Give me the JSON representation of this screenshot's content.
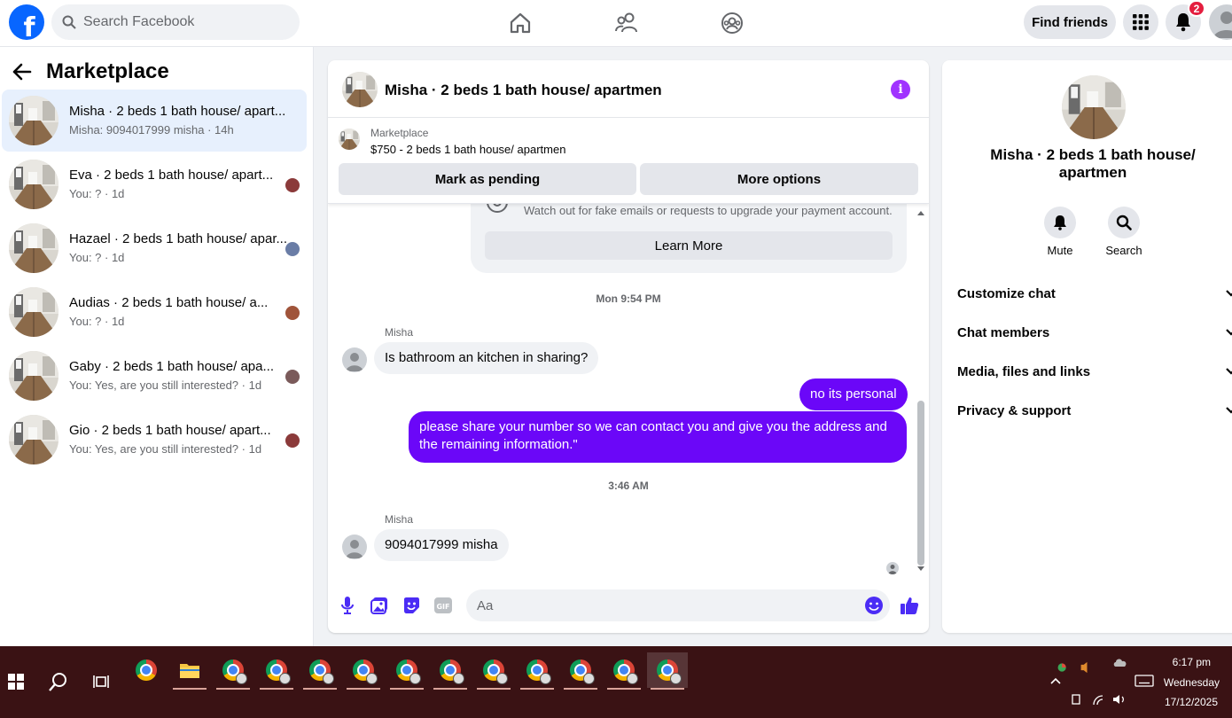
{
  "topbar": {
    "search_placeholder": "Search Facebook",
    "find_friends_label": "Find friends",
    "notification_count": "2",
    "brand_color": "#0866ff"
  },
  "sidebar": {
    "title": "Marketplace",
    "conversations": [
      {
        "title": "Misha · 2 beds 1 bath house/ apart...",
        "subtitle": "Misha: 9094017999 misha · 14h",
        "active": true
      },
      {
        "title": "Eva · 2 beds 1 bath house/ apart...",
        "subtitle": "You: ? · 1d"
      },
      {
        "title": "Hazael · 2 beds 1 bath house/ apar...",
        "subtitle": "You: ? · 1d"
      },
      {
        "title": "Audias · 2 beds 1 bath house/ a...",
        "subtitle": "You: ? · 1d"
      },
      {
        "title": "Gaby · 2 beds 1 bath house/ apa...",
        "subtitle": "You: Yes, are you still interested? · 1d"
      },
      {
        "title": "Gio · 2 beds 1 bath house/ apart...",
        "subtitle": "You: Yes, are you still interested? · 1d"
      }
    ]
  },
  "chat": {
    "title": "Misha · 2 beds 1 bath house/ apartmen",
    "listing": {
      "category": "Marketplace",
      "price_title": "$750 - 2 beds 1 bath house/ apartmen",
      "mark_pending_label": "Mark as pending",
      "more_options_label": "More options"
    },
    "scam_notice": {
      "text": "Watch out for fake emails or requests to upgrade your payment account.",
      "learn_more_label": "Learn More"
    },
    "timestamp_1": "Mon 9:54 PM",
    "timestamp_2": "3:46 AM",
    "sender_name": "Misha",
    "messages": [
      {
        "from": "Misha",
        "text": "Is bathroom an kitchen in sharing?"
      },
      {
        "from": "me",
        "text": "no its personal"
      },
      {
        "from": "me",
        "text": "please share your number so we can contact you and give you the address and the remaining information.\""
      },
      {
        "from": "Misha",
        "text": "9094017999 misha"
      }
    ],
    "composer_placeholder": "Aa",
    "accent_color": "#6b07f8"
  },
  "details": {
    "title": "Misha · 2 beds 1 bath house/ apartmen",
    "mute_label": "Mute",
    "search_label": "Search",
    "sections": [
      "Customize chat",
      "Chat members",
      "Media, files and links",
      "Privacy & support"
    ]
  },
  "taskbar": {
    "time": "6:17 pm",
    "day": "Wednesday",
    "date": "17/12/2025"
  }
}
